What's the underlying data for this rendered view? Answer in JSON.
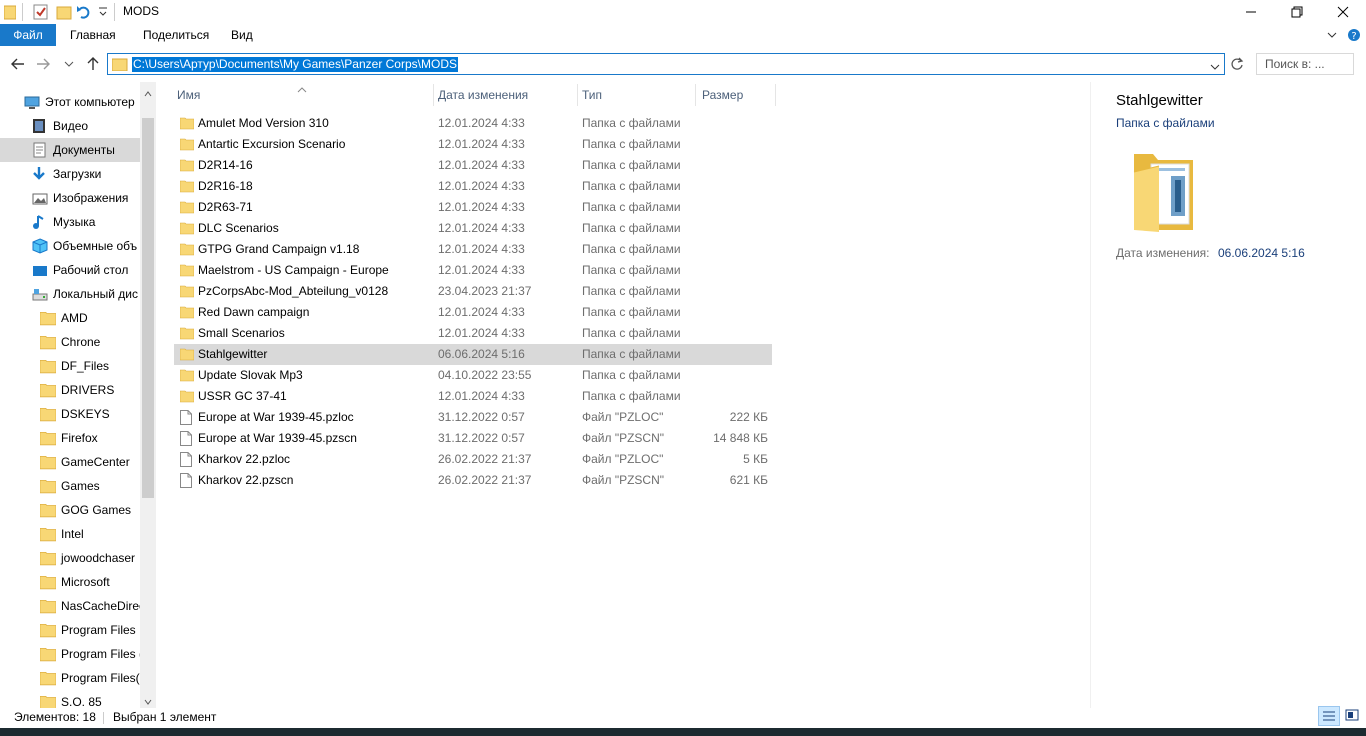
{
  "window": {
    "title": "MODS"
  },
  "ribbon": {
    "tabs": [
      "Файл",
      "Главная",
      "Поделиться",
      "Вид"
    ]
  },
  "address": {
    "path": "C:\\Users\\Артур\\Documents\\My Games\\Panzer Corps\\MODS",
    "search_placeholder": "Поиск в: ..."
  },
  "sidebar": {
    "items": [
      {
        "label": "Этот компьютер",
        "icon": "computer-icon",
        "indent": 0
      },
      {
        "label": "Видео",
        "icon": "video-icon",
        "indent": 1
      },
      {
        "label": "Документы",
        "icon": "documents-icon",
        "indent": 1,
        "selected": true
      },
      {
        "label": "Загрузки",
        "icon": "downloads-icon",
        "indent": 1
      },
      {
        "label": "Изображения",
        "icon": "pictures-icon",
        "indent": 1
      },
      {
        "label": "Музыка",
        "icon": "music-icon",
        "indent": 1
      },
      {
        "label": "Объемные объ",
        "icon": "3d-objects-icon",
        "indent": 1
      },
      {
        "label": "Рабочий стол",
        "icon": "desktop-icon",
        "indent": 1
      },
      {
        "label": "Локальный дис",
        "icon": "drive-icon",
        "indent": 1
      },
      {
        "label": "AMD",
        "icon": "folder-icon",
        "indent": 2
      },
      {
        "label": "Chrone",
        "icon": "folder-icon",
        "indent": 2
      },
      {
        "label": "DF_Files",
        "icon": "folder-icon",
        "indent": 2
      },
      {
        "label": "DRIVERS",
        "icon": "folder-icon",
        "indent": 2
      },
      {
        "label": "DSKEYS",
        "icon": "folder-icon",
        "indent": 2
      },
      {
        "label": "Firefox",
        "icon": "folder-icon",
        "indent": 2
      },
      {
        "label": "GameCenter",
        "icon": "folder-icon",
        "indent": 2
      },
      {
        "label": "Games",
        "icon": "folder-icon",
        "indent": 2
      },
      {
        "label": "GOG Games",
        "icon": "folder-icon",
        "indent": 2
      },
      {
        "label": "Intel",
        "icon": "folder-icon",
        "indent": 2
      },
      {
        "label": "jowoodchaser",
        "icon": "folder-icon",
        "indent": 2
      },
      {
        "label": "Microsoft",
        "icon": "folder-icon",
        "indent": 2
      },
      {
        "label": "NasCacheDirec",
        "icon": "folder-icon",
        "indent": 2
      },
      {
        "label": "Program Files",
        "icon": "folder-icon",
        "indent": 2
      },
      {
        "label": "Program Files (",
        "icon": "folder-icon",
        "indent": 2
      },
      {
        "label": "Program Files(:",
        "icon": "folder-icon",
        "indent": 2
      },
      {
        "label": "S.O. 85",
        "icon": "folder-icon",
        "indent": 2
      }
    ]
  },
  "columns": {
    "name": "Имя",
    "date": "Дата изменения",
    "type": "Тип",
    "size": "Размер"
  },
  "files": [
    {
      "name": "Amulet Mod Version 310",
      "date": "12.01.2024 4:33",
      "type": "Папка с файлами",
      "size": "",
      "kind": "folder"
    },
    {
      "name": "Antartic Excursion Scenario",
      "date": "12.01.2024 4:33",
      "type": "Папка с файлами",
      "size": "",
      "kind": "folder"
    },
    {
      "name": "D2R14-16",
      "date": "12.01.2024 4:33",
      "type": "Папка с файлами",
      "size": "",
      "kind": "folder"
    },
    {
      "name": "D2R16-18",
      "date": "12.01.2024 4:33",
      "type": "Папка с файлами",
      "size": "",
      "kind": "folder"
    },
    {
      "name": "D2R63-71",
      "date": "12.01.2024 4:33",
      "type": "Папка с файлами",
      "size": "",
      "kind": "folder"
    },
    {
      "name": "DLC Scenarios",
      "date": "12.01.2024 4:33",
      "type": "Папка с файлами",
      "size": "",
      "kind": "folder"
    },
    {
      "name": "GTPG Grand Campaign v1.18",
      "date": "12.01.2024 4:33",
      "type": "Папка с файлами",
      "size": "",
      "kind": "folder"
    },
    {
      "name": "Maelstrom - US Campaign - Europe",
      "date": "12.01.2024 4:33",
      "type": "Папка с файлами",
      "size": "",
      "kind": "folder"
    },
    {
      "name": "PzCorpsAbc-Mod_Abteilung_v0128",
      "date": "23.04.2023 21:37",
      "type": "Папка с файлами",
      "size": "",
      "kind": "folder"
    },
    {
      "name": "Red Dawn campaign",
      "date": "12.01.2024 4:33",
      "type": "Папка с файлами",
      "size": "",
      "kind": "folder"
    },
    {
      "name": "Small Scenarios",
      "date": "12.01.2024 4:33",
      "type": "Папка с файлами",
      "size": "",
      "kind": "folder"
    },
    {
      "name": "Stahlgewitter",
      "date": "06.06.2024 5:16",
      "type": "Папка с файлами",
      "size": "",
      "kind": "folder",
      "selected": true
    },
    {
      "name": "Update  Slovak Mp3",
      "date": "04.10.2022 23:55",
      "type": "Папка с файлами",
      "size": "",
      "kind": "folder"
    },
    {
      "name": "USSR GC 37-41",
      "date": "12.01.2024 4:33",
      "type": "Папка с файлами",
      "size": "",
      "kind": "folder"
    },
    {
      "name": "Europe at War 1939-45.pzloc",
      "date": "31.12.2022 0:57",
      "type": "Файл \"PZLOC\"",
      "size": "222 КБ",
      "kind": "file"
    },
    {
      "name": "Europe at War 1939-45.pzscn",
      "date": "31.12.2022 0:57",
      "type": "Файл \"PZSCN\"",
      "size": "14 848 КБ",
      "kind": "file"
    },
    {
      "name": "Kharkov 22.pzloc",
      "date": "26.02.2022 21:37",
      "type": "Файл \"PZLOC\"",
      "size": "5 КБ",
      "kind": "file"
    },
    {
      "name": "Kharkov 22.pzscn",
      "date": "26.02.2022 21:37",
      "type": "Файл \"PZSCN\"",
      "size": "621 КБ",
      "kind": "file"
    }
  ],
  "preview": {
    "name": "Stahlgewitter",
    "type": "Папка с файлами",
    "date_label": "Дата изменения:",
    "date_value": "06.06.2024 5:16"
  },
  "status": {
    "count": "Элементов: 18",
    "selected": "Выбран 1 элемент"
  }
}
